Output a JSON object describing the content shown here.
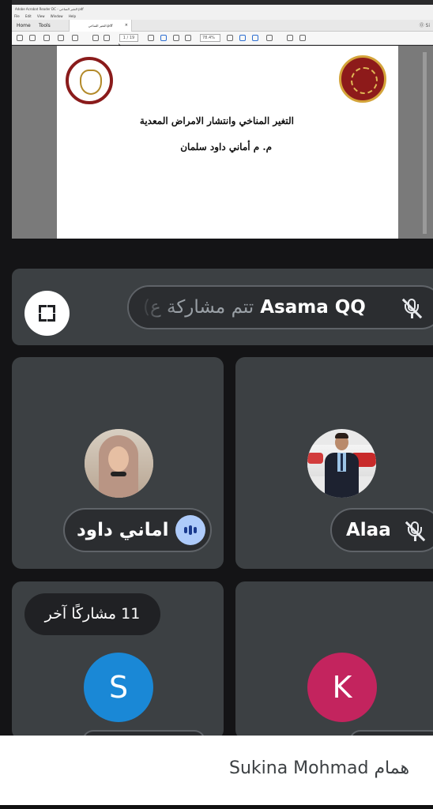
{
  "acrobat": {
    "title": "Adobe Acrobat Reader DC - التغير المناخي pdf",
    "menu": [
      "File",
      "Edit",
      "View",
      "Window",
      "Help"
    ],
    "tabs": {
      "home": "Home",
      "tools": "Tools",
      "document": "التغير المناخي.pdf"
    },
    "page_number": "1 / 19",
    "zoom": "78.4%",
    "right_label": "Si"
  },
  "document": {
    "title": "التغير المناخي وانتشار الامراض المعدية",
    "author": "م. م أماني داود سلمان"
  },
  "presenter": {
    "name": "Asama QQ",
    "status": "(تتم مشاركة ع",
    "mic": "mic-off-icon"
  },
  "participants": [
    {
      "name": "اماني داود",
      "mic": "speaking-icon",
      "speaking_color": "#aecbfa"
    },
    {
      "name": "Alaa",
      "mic": "mic-off-icon"
    }
  ],
  "others": {
    "label": "11 مشاركًا آخر"
  },
  "letter_avatars": [
    {
      "letter": "S",
      "color": "#1a88d6"
    },
    {
      "letter": "K",
      "color": "#c3245e"
    }
  ],
  "caption": {
    "text": "Sukina Mohmad همام"
  },
  "colors": {
    "tile": "#3c4043",
    "background": "#141416",
    "pill_border": "#5f6368"
  }
}
